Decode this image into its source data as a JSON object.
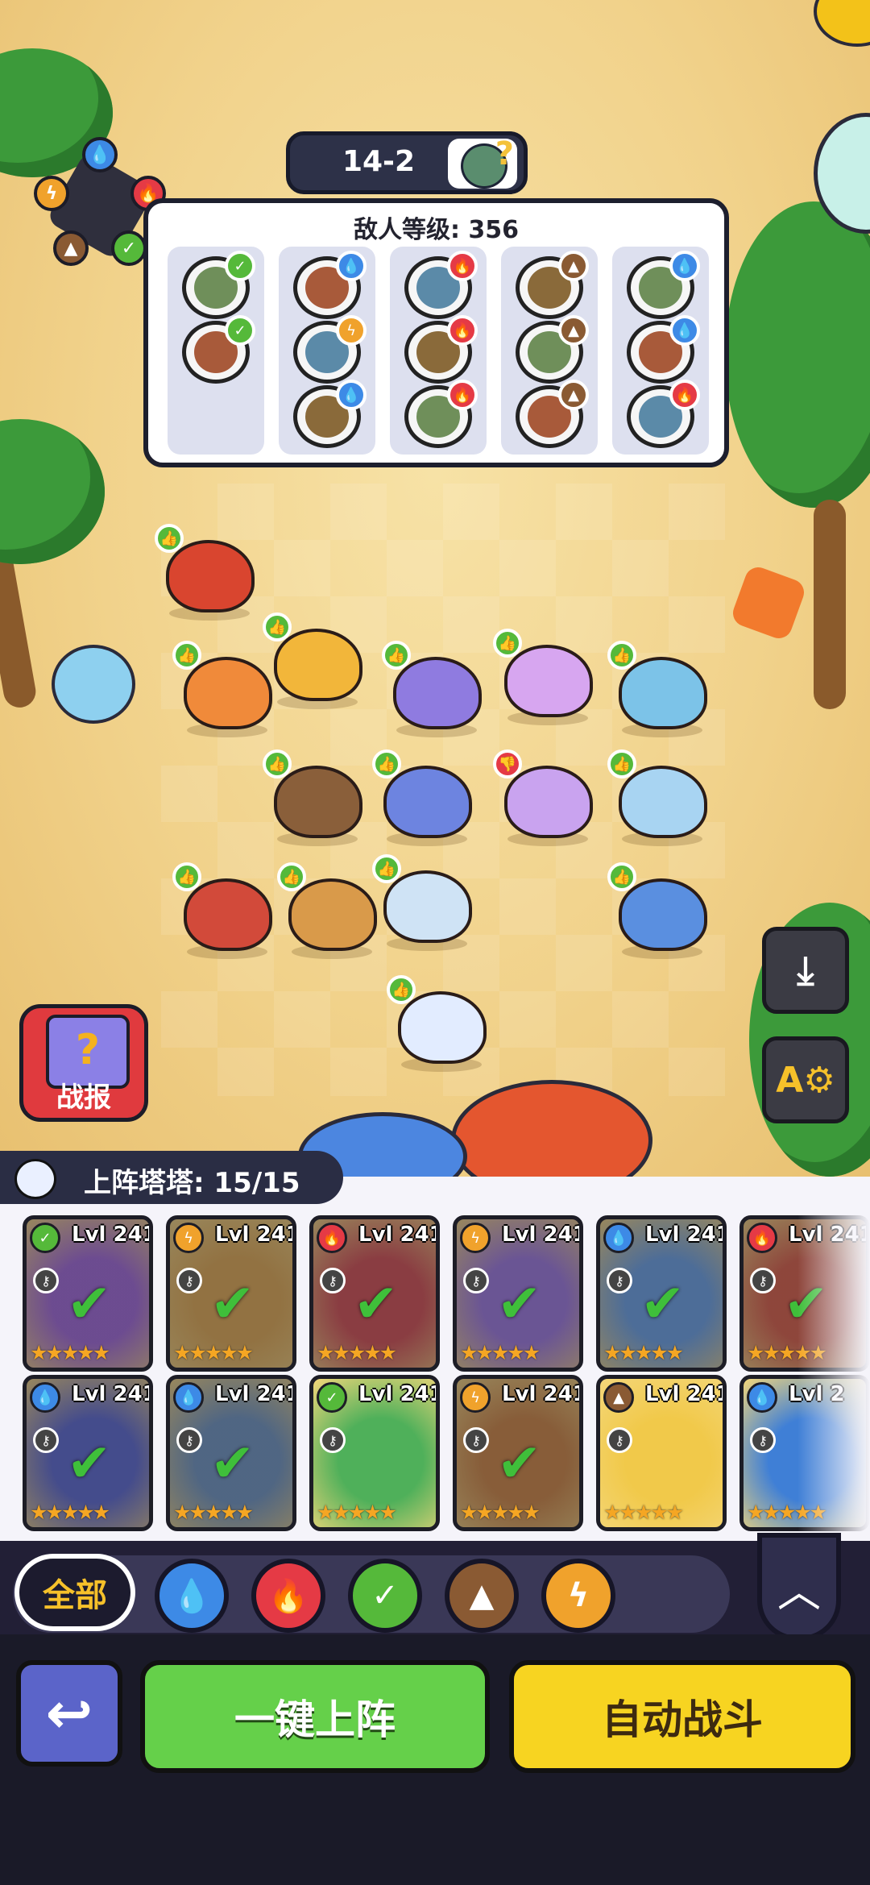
{
  "stage": {
    "level": "14-2",
    "enemy_icon": "zombie-question-icon"
  },
  "element_wheel": {
    "icons": [
      "water-icon",
      "fire-icon",
      "grass-icon",
      "earth-icon",
      "bolt-icon"
    ]
  },
  "enemy_panel": {
    "title": "敌人等级: 356",
    "columns": [
      {
        "enemies": [
          {
            "element": "grass"
          },
          {
            "element": "grass"
          }
        ]
      },
      {
        "enemies": [
          {
            "element": "water"
          },
          {
            "element": "bolt"
          },
          {
            "element": "water"
          }
        ]
      },
      {
        "enemies": [
          {
            "element": "fire"
          },
          {
            "element": "fire"
          },
          {
            "element": "fire"
          }
        ]
      },
      {
        "enemies": [
          {
            "element": "earth"
          },
          {
            "element": "earth"
          },
          {
            "element": "earth"
          }
        ]
      },
      {
        "enemies": [
          {
            "element": "water"
          },
          {
            "element": "water"
          },
          {
            "element": "fire"
          }
        ]
      }
    ]
  },
  "colors": {
    "water": "#3d8ae6",
    "fire": "#e53a45",
    "grass": "#55b93a",
    "earth": "#8a5a33",
    "bolt": "#f0a22c",
    "deploy_green": "#65d04a",
    "auto_yellow": "#f7d421"
  },
  "report_button": {
    "label": "战报",
    "icon": "question-clipboard-icon"
  },
  "side_buttons": {
    "save_icon": "download-icon",
    "auto_settings_icon": "auto-gear-icon"
  },
  "team": {
    "label": "上阵塔塔: 15/15"
  },
  "cards": [
    {
      "element": "grass",
      "level": "Lvl 241",
      "deployed": true,
      "stars": "★★★★★"
    },
    {
      "element": "bolt",
      "level": "Lvl 241",
      "deployed": true,
      "stars": "★★★★★"
    },
    {
      "element": "fire",
      "level": "Lvl 241",
      "deployed": true,
      "stars": "★★★★★"
    },
    {
      "element": "bolt",
      "level": "Lvl 241",
      "deployed": true,
      "stars": "★★★★★"
    },
    {
      "element": "water",
      "level": "Lvl 241",
      "deployed": true,
      "stars": "★★★★★"
    },
    {
      "element": "fire",
      "level": "Lvl 241",
      "deployed": true,
      "stars": "★★★★★"
    },
    {
      "element": "water",
      "level": "Lvl 241",
      "deployed": true,
      "stars": "★★★★★"
    },
    {
      "element": "water",
      "level": "Lvl 241",
      "deployed": true,
      "stars": "★★★★★"
    },
    {
      "element": "grass",
      "level": "Lvl 241",
      "deployed": false,
      "stars": "★★★★★"
    },
    {
      "element": "bolt",
      "level": "Lvl 241",
      "deployed": true,
      "stars": "★★★★★"
    },
    {
      "element": "earth",
      "level": "Lvl 241",
      "deployed": false,
      "stars": "★★★★★"
    },
    {
      "element": "water",
      "level": "Lvl 2",
      "deployed": false,
      "stars": "★★★★★"
    }
  ],
  "filters": {
    "all_label": "全部",
    "chips": [
      "water-icon",
      "fire-icon",
      "grass-icon",
      "earth-icon",
      "bolt-icon"
    ],
    "collapse_icon": "chevron-up-icon"
  },
  "actions": {
    "back_icon": "return-arrow-icon",
    "deploy_label": "一键上阵",
    "auto_battle_label": "自动战斗"
  }
}
